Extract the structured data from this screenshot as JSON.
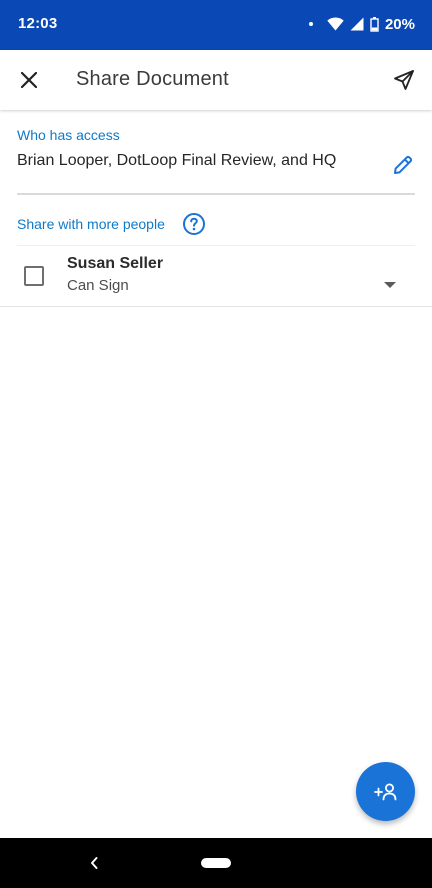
{
  "status_bar": {
    "time": "12:03",
    "battery": "20%",
    "background": "#0a49b5"
  },
  "app_bar": {
    "title": "Share Document",
    "close_icon": "close-icon",
    "send_icon": "send-icon"
  },
  "access": {
    "label": "Who has access",
    "value": "Brian Looper, DotLoop Final Review, and HQ",
    "edit_icon": "pencil-icon"
  },
  "share_more": {
    "label": "Share with more people",
    "help_icon": "help-icon"
  },
  "people": [
    {
      "name": "Susan Seller",
      "permission": "Can Sign",
      "checked": false
    }
  ],
  "fab": {
    "icon": "add-person-icon",
    "color": "#1a73d6"
  },
  "colors": {
    "accent": "#0f7ac7",
    "brand": "#0a49b5"
  }
}
